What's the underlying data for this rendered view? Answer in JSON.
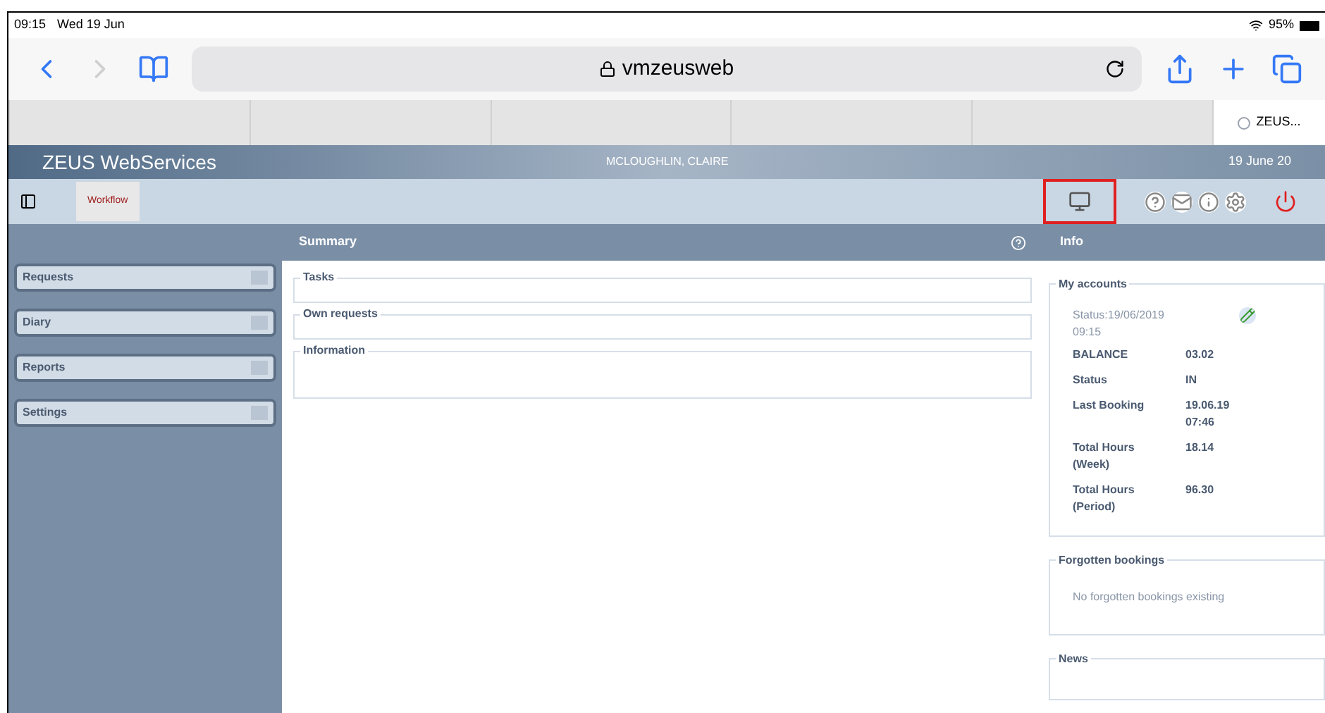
{
  "status_bar": {
    "time": "09:15",
    "date": "Wed 19 Jun",
    "battery": "95%"
  },
  "browser": {
    "url": "vmzeusweb",
    "tabs": [
      {
        "selected": false
      },
      {
        "selected": false
      },
      {
        "selected": false
      },
      {
        "selected": false
      },
      {
        "selected": false
      },
      {
        "label": "ZEUS...",
        "selected": true
      }
    ]
  },
  "header": {
    "title": "ZEUS WebServices",
    "user": "MCLOUGHLIN, CLAIRE",
    "date": "19 June 20"
  },
  "toolbar": {
    "tab": "Workflow",
    "terminal_highlighted": true
  },
  "sidebar": {
    "items": [
      {
        "label": "Requests"
      },
      {
        "label": "Diary"
      },
      {
        "label": "Reports"
      },
      {
        "label": "Settings"
      }
    ]
  },
  "summary": {
    "title": "Summary",
    "groups": [
      {
        "title": "Tasks",
        "kind": "short"
      },
      {
        "title": "Own requests",
        "kind": "short"
      },
      {
        "title": "Information",
        "kind": "tall"
      }
    ]
  },
  "info": {
    "title": "Info",
    "accounts": {
      "title": "My accounts",
      "status": "Status:19/06/2019 09:15",
      "rows": [
        {
          "label": "BALANCE",
          "value": "03.02"
        },
        {
          "label": "Status",
          "value": "IN"
        },
        {
          "label": "Last Booking",
          "value": "19.06.19 07:46"
        },
        {
          "label": "Total Hours (Week)",
          "value": "18.14"
        },
        {
          "label": "Total Hours (Period)",
          "value": "96.30"
        }
      ]
    },
    "forgotten": {
      "title": "Forgotten bookings",
      "text": "No forgotten bookings existing"
    },
    "news": {
      "title": "News"
    }
  }
}
